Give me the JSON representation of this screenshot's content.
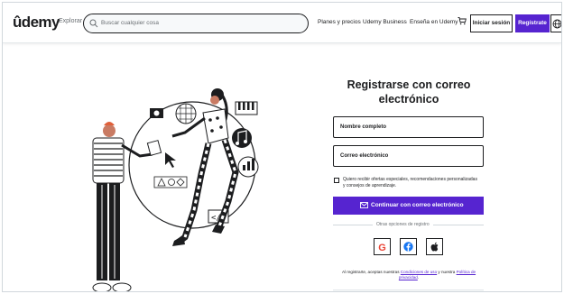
{
  "header": {
    "logo_text": "ûdemy",
    "explore_label": "Explorar",
    "search_placeholder": "Buscar cualquier cosa",
    "nav": {
      "plans": "Planes y precios",
      "business": "Udemy Business",
      "teach": "Enseña en Udemy"
    },
    "login_label": "Iniciar sesión",
    "signup_label": "Regístrate"
  },
  "form": {
    "title_line1": "Registrarse con correo",
    "title_line2": "electrónico",
    "name_label": "Nombre completo",
    "email_label": "Correo electrónico",
    "offers_label": "Quiero recibir ofertas especiales, recomendaciones personalizadas y consejos de aprendizaje.",
    "continue_label": "Continuar con correo electrónico",
    "other_options": "Otras opciones de registro",
    "terms_prefix": "Al registrarte, aceptas nuestras ",
    "terms_link": "Condiciones de uso",
    "terms_middle": " y nuestra ",
    "privacy_link": "Política de privacidad",
    "terms_suffix": "."
  },
  "social": [
    {
      "icon": "google-icon",
      "glyph": "G",
      "color": "#ea4335"
    },
    {
      "icon": "facebook-icon",
      "glyph": "f",
      "color": "#1877f2"
    },
    {
      "icon": "apple-icon",
      "glyph": "",
      "color": "#1c1d1f"
    }
  ],
  "colors": {
    "brand_purple": "#5624d0",
    "accent_purple": "#a435f0",
    "text": "#1c1d1f",
    "border": "#d1d7dc"
  }
}
